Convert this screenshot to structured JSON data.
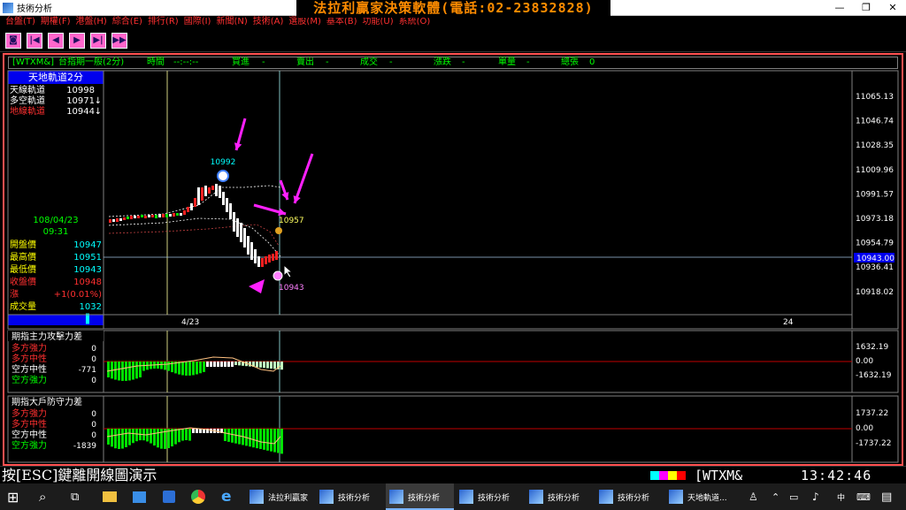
{
  "window": {
    "title": "技術分析",
    "controls": [
      "—",
      "❐",
      "✕"
    ]
  },
  "banner": "法拉利贏家決策軟體(電話:02-23832828)",
  "menu": [
    "台盤(T)",
    "期權(F)",
    "港盤(H)",
    "綜合(E)",
    "排行(R)",
    "國際(I)",
    "新聞(N)",
    "技術(A)",
    "選股(M)",
    "基本(B)",
    "功能(U)",
    "系統(O)"
  ],
  "toolbar": {
    "buttons": [
      "esc-icon",
      "first-icon",
      "prev-icon",
      "next-icon",
      "last-icon",
      "fast-forward-icon"
    ],
    "glyphs": [
      "◙",
      "|◀",
      "◀",
      "▶",
      "▶|",
      "▶▶"
    ]
  },
  "infobar": {
    "symbol": "[WTXM&]",
    "name": "台指期一般(2分)",
    "time_label": "時間",
    "time_value": "--:--:--",
    "buy_label": "買進",
    "buy_value": "-",
    "sell_label": "賣出",
    "sell_value": "-",
    "deal_label": "成交",
    "deal_value": "-",
    "change_label": "漲跌",
    "change_value": "-",
    "vol_label": "單量",
    "vol_value": "-",
    "total_label": "總張",
    "total_value": "0"
  },
  "left_panel": {
    "title": "天地軌道2分",
    "tracks": [
      {
        "label": "天線軌道",
        "value": "10998",
        "arrow": "",
        "color": "#ffffff"
      },
      {
        "label": "多空軌道",
        "value": "10971",
        "arrow": "↓",
        "color": "#ffffff"
      },
      {
        "label": "地線軌道",
        "value": "10944",
        "arrow": "↓",
        "color": "#ff3030"
      }
    ],
    "date": "108/04/23",
    "time": "09:31",
    "quotes": [
      {
        "label": "開盤價",
        "value": "10947",
        "lcolor": "#ffff00",
        "vcolor": "#00ffff"
      },
      {
        "label": "最高價",
        "value": "10951",
        "lcolor": "#ffff00",
        "vcolor": "#00ffff"
      },
      {
        "label": "最低價",
        "value": "10943",
        "lcolor": "#ffff00",
        "vcolor": "#00ffff"
      },
      {
        "label": "收盤價",
        "value": "10948",
        "lcolor": "#ff3030",
        "vcolor": "#ff3030"
      },
      {
        "label": "漲",
        "value": "+1(0.01%)",
        "lcolor": "#ff3030",
        "vcolor": "#ff3030"
      },
      {
        "label": "成交量",
        "value": "1032",
        "lcolor": "#ffff00",
        "vcolor": "#00ffff"
      }
    ],
    "scroll_marker": "▌"
  },
  "main_chart": {
    "y_ticks": [
      "11065.13",
      "11046.74",
      "11028.35",
      "11009.96",
      "10991.57",
      "10973.18",
      "10954.79",
      "10936.41",
      "10918.02"
    ],
    "current_price": "10943.00",
    "annotations": {
      "high": "10992",
      "mid": "10957",
      "low": "10943"
    },
    "x_labels": {
      "date": "4/23",
      "next": "24"
    }
  },
  "panel2": {
    "title": "期指主力攻擊力差",
    "rows": [
      {
        "label": "多方強力",
        "value": "0",
        "color": "#ff3030"
      },
      {
        "label": "多方中性",
        "value": "0",
        "color": "#ff3030"
      },
      {
        "label": "空方中性",
        "value": "-771",
        "color": "#ffffff"
      },
      {
        "label": "空方強力",
        "value": "0",
        "color": "#00ff00"
      }
    ],
    "y_ticks": [
      "1632.19",
      "0.00",
      "-1632.19"
    ]
  },
  "panel3": {
    "title": "期指大戶防守力差",
    "rows": [
      {
        "label": "多方強力",
        "value": "0",
        "color": "#ff3030"
      },
      {
        "label": "多方中性",
        "value": "0",
        "color": "#ff3030"
      },
      {
        "label": "空方中性",
        "value": "0",
        "color": "#ffffff"
      },
      {
        "label": "空方強力",
        "value": "-1839",
        "color": "#00ff00"
      }
    ],
    "y_ticks": [
      "1737.22",
      "0.00",
      "-1737.22"
    ]
  },
  "status": {
    "message": "按[ESC]鍵離開線圖演示",
    "symbol": "[WTXM&",
    "clock": "13:42:46",
    "colors": [
      "#00ffff",
      "#ff00ff",
      "#ffff00",
      "#ff0000"
    ]
  },
  "taskbar": {
    "items": [
      {
        "label": "法拉利贏家",
        "active": false
      },
      {
        "label": "技術分析",
        "active": false
      },
      {
        "label": "技術分析",
        "active": true
      },
      {
        "label": "技術分析",
        "active": false
      },
      {
        "label": "技術分析",
        "active": false
      },
      {
        "label": "技術分析",
        "active": false
      },
      {
        "label": "天地軌道...",
        "active": false
      }
    ],
    "ime": "中"
  }
}
